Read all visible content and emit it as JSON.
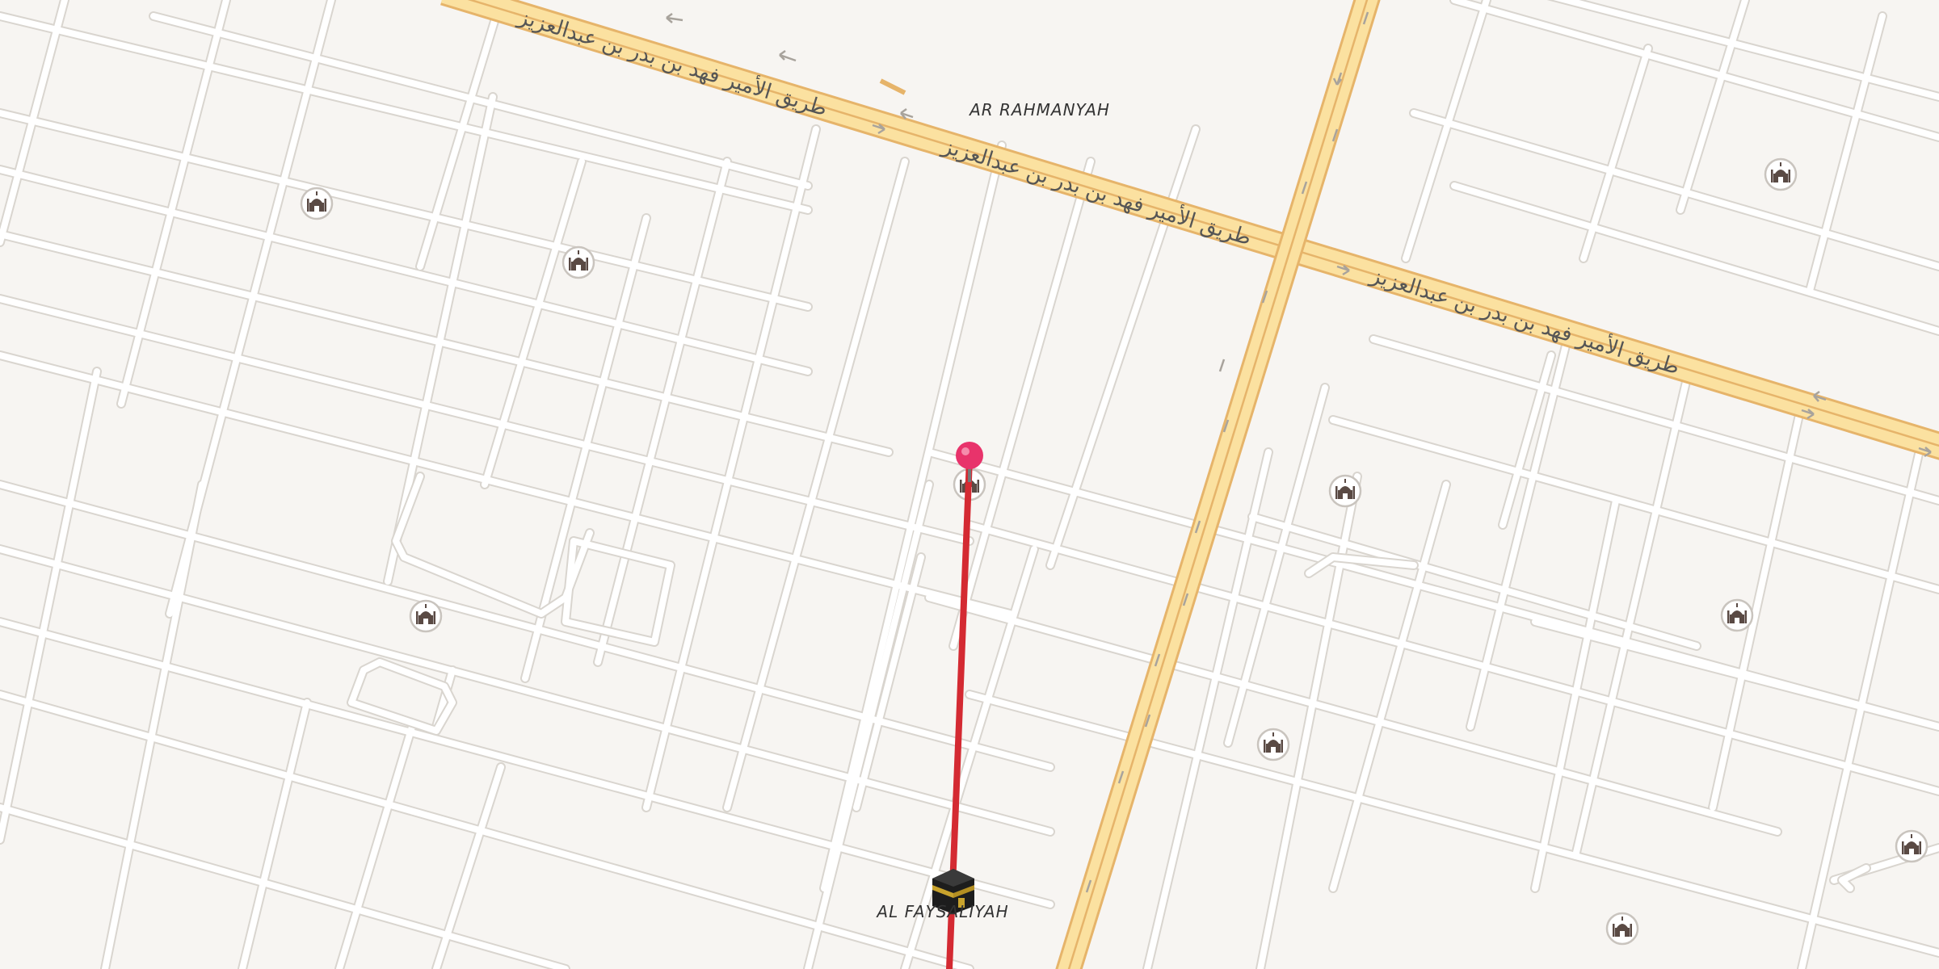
{
  "map": {
    "districts": {
      "north": "AR RAHMANYAH",
      "south": "AL FAYSALIYAH"
    },
    "road_labels": {
      "highway_1": "طريق الأمير فهد بن بدر بن عبدالعزيز",
      "highway_2": "طريق الأمير فهد بن بدر بن عبدالعزيز",
      "highway_3": "طريق الأمير فهد بن بدر بن عبدالعزيز"
    },
    "colors": {
      "background": "#f7f5f2",
      "street": "#ffffff",
      "street_casing": "#dcd8d2",
      "highway_fill": "#fbe2a2",
      "highway_casing": "#e8b868",
      "route_line": "#d42a32",
      "pin": "#e8336b",
      "mosque_icon": "#5a4a44"
    },
    "markers": {
      "pin": "destination-pin-icon",
      "kaaba": "kaaba-icon",
      "mosque": "mosque-icon"
    }
  }
}
